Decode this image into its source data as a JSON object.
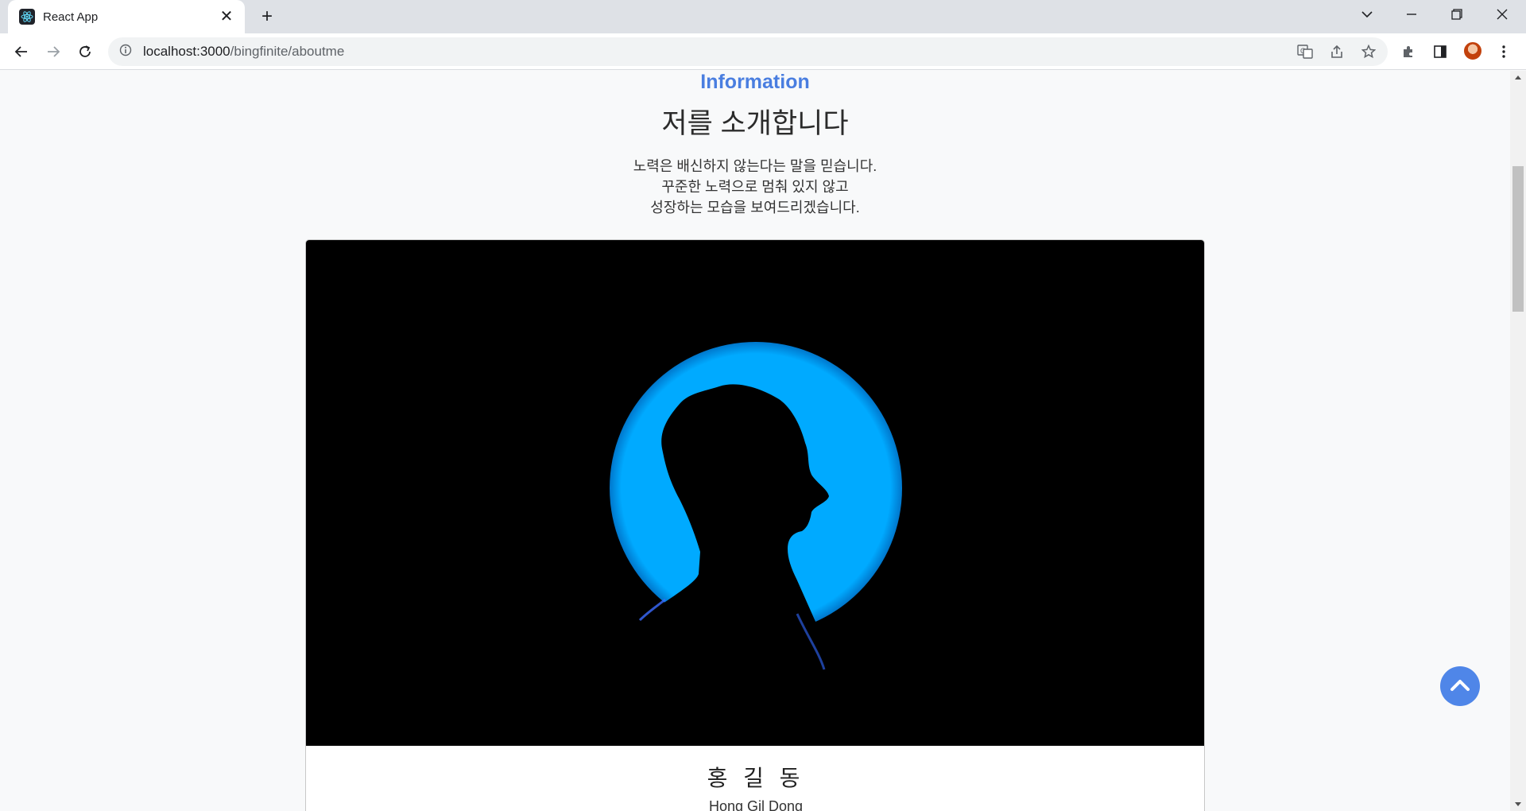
{
  "browser": {
    "tab_title": "React App",
    "url_host": "localhost:3000",
    "url_path": "/bingfinite/aboutme"
  },
  "page": {
    "section_label": "Information",
    "section_title": "저를 소개합니다",
    "intro_lines": [
      "노력은 배신하지 않는다는 말을 믿습니다.",
      "꾸준한 노력으로 멈춰 있지 않고",
      "성장하는 모습을 보여드리겠습니다."
    ],
    "profile": {
      "name_ko": "홍 길 동",
      "name_en": "Hong Gil Dong"
    }
  },
  "colors": {
    "accent": "#4a7ee0",
    "photo_circle": "#00aaff",
    "photo_bg": "#000000",
    "top_button": "#4f86e8"
  },
  "icons": {
    "favicon": "react-icon",
    "scroll_top": "chevron-up-icon"
  }
}
